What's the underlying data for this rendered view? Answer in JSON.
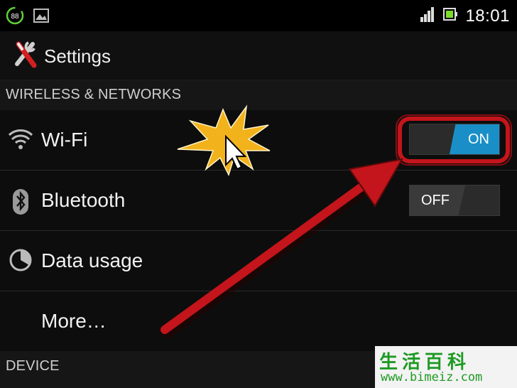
{
  "status_bar": {
    "left_icons": [
      "battery-saver-icon",
      "image-icon"
    ],
    "battery_saver_text": "88",
    "right_icons": [
      "signal-icon",
      "battery-icon"
    ],
    "time": "18:01"
  },
  "action_bar": {
    "icon": "wrench-screwdriver-icon",
    "title": "Settings"
  },
  "sections": {
    "wireless": "WIRELESS & NETWORKS",
    "device": "DEVICE"
  },
  "items": [
    {
      "label": "Wi-Fi",
      "icon": "wifi-icon",
      "toggle": "ON"
    },
    {
      "label": "Bluetooth",
      "icon": "bluetooth-icon",
      "toggle": "OFF"
    },
    {
      "label": "Data usage",
      "icon": "data-usage-icon"
    },
    {
      "label": "More…"
    }
  ],
  "watermark": {
    "chinese": "生活百科",
    "url": "www.bimeiz.com"
  },
  "colors": {
    "toggle_on": "#1a8fc7",
    "highlight": "#c3151b",
    "starburst": "#f2b21b"
  }
}
